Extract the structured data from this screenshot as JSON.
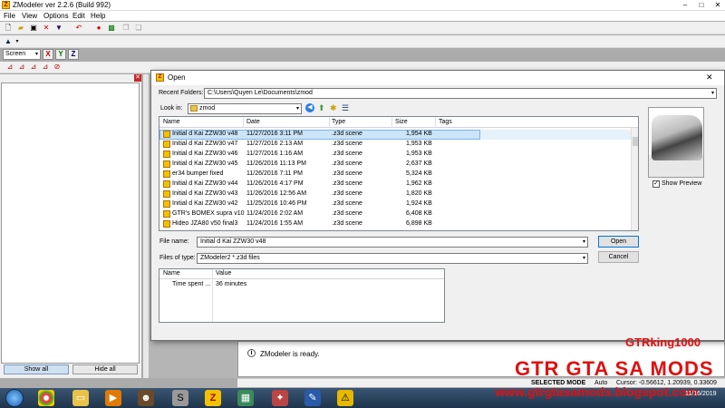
{
  "app": {
    "title": "ZModeler ver 2.2.6 (Build 992)",
    "menu": [
      "File",
      "View",
      "Options",
      "Edit",
      "Help"
    ]
  },
  "toolbar": {
    "view_mode": "Screen",
    "axes": [
      "X",
      "Y",
      "Z"
    ]
  },
  "left_panel": {
    "show_all": "Show all",
    "hide_all": "Hide all"
  },
  "dialog": {
    "title": "Open",
    "recent_folders_label": "Recent Folders:",
    "recent_folders_value": "C:\\Users\\Quyen Le\\Documents\\zmod",
    "look_in_label": "Look in:",
    "look_in_value": "zmod",
    "columns": [
      "Name",
      "Date",
      "Type",
      "Size",
      "Tags"
    ],
    "files": [
      {
        "name": "Initial d Kai ZZW30 v48",
        "date": "11/27/2016 3:11 PM",
        "type": ".z3d scene",
        "size": "1,954 KB"
      },
      {
        "name": "Initial d Kai ZZW30 v47",
        "date": "11/27/2016 2:13 AM",
        "type": ".z3d scene",
        "size": "1,953 KB"
      },
      {
        "name": "Initial d Kai ZZW30 v46",
        "date": "11/27/2016 1:16 AM",
        "type": ".z3d scene",
        "size": "1,953 KB"
      },
      {
        "name": "Initial d Kai ZZW30 v45",
        "date": "11/26/2016 11:13 PM",
        "type": ".z3d scene",
        "size": "2,637 KB"
      },
      {
        "name": "er34 bumper fixed",
        "date": "11/26/2016 7:11 PM",
        "type": ".z3d scene",
        "size": "5,324 KB"
      },
      {
        "name": "Initial d Kai ZZW30 v44",
        "date": "11/26/2016 4:17 PM",
        "type": ".z3d scene",
        "size": "1,962 KB"
      },
      {
        "name": "Initial d Kai ZZW30 v43",
        "date": "11/26/2016 12:56 AM",
        "type": ".z3d scene",
        "size": "1,820 KB"
      },
      {
        "name": "Initial d Kai ZZW30 v42",
        "date": "11/25/2016 10:46 PM",
        "type": ".z3d scene",
        "size": "1,924 KB"
      },
      {
        "name": "GTR's BOMEX supra v10",
        "date": "11/24/2016 2:02 AM",
        "type": ".z3d scene",
        "size": "6,408 KB"
      },
      {
        "name": "Hideo JZA80 v50 final3",
        "date": "11/24/2016 1:55 AM",
        "type": ".z3d scene",
        "size": "6,898 KB"
      }
    ],
    "show_preview": "Show Preview",
    "file_name_label": "File name:",
    "file_name_value": "Initial d Kai ZZW30 v48",
    "files_of_type_label": "Files of type:",
    "files_of_type_value": "ZModeler2 *.z3d files",
    "open_button": "Open",
    "cancel_button": "Cancel",
    "props_columns": [
      "Name",
      "Value"
    ],
    "props": [
      {
        "name": "Time spent ...",
        "value": "36 minutes"
      }
    ]
  },
  "console": {
    "message": "ZModeler is ready."
  },
  "status": {
    "mode": "SELECTED MODE",
    "auto": "Auto",
    "cursor": "Cursor: -0.56612, 1.20939, 0.33609"
  },
  "taskbar": {
    "date": "11/16/2019"
  },
  "watermark": {
    "line1": "GTRking1000",
    "line2": "GTR GTA SA MODS",
    "line3": "www.gtrgtasamods.blogspot.com"
  }
}
